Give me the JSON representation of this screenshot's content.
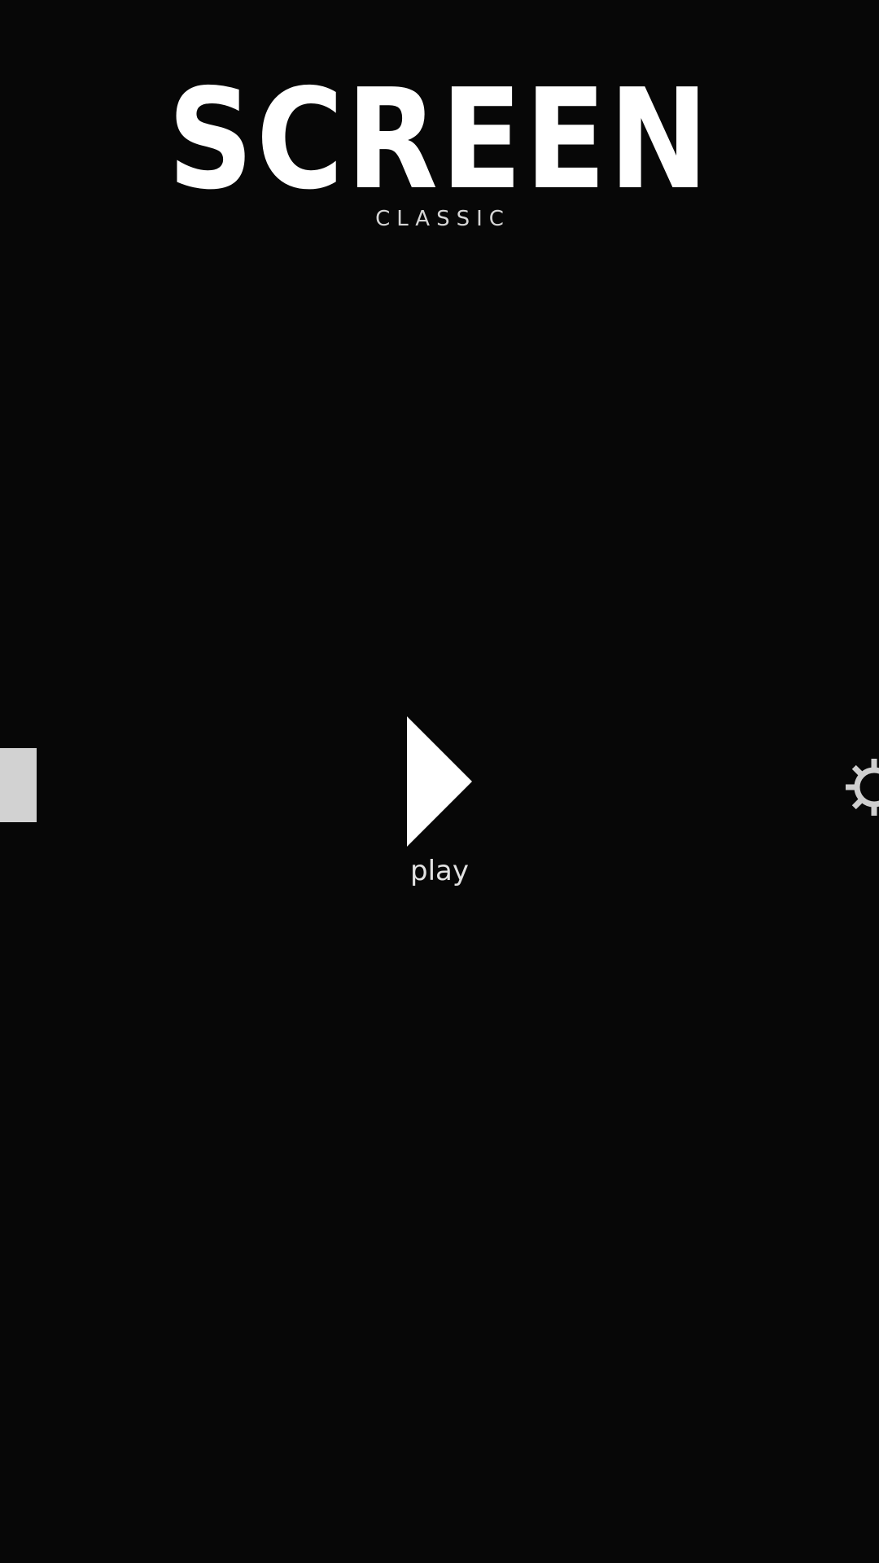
{
  "header": {
    "title": "SCREEN",
    "subtitle": "CLASSIC"
  },
  "play": {
    "label": "play",
    "icon": "play-triangle-icon"
  },
  "side_controls": {
    "left_tab_icon": "panel-tab-icon",
    "right_icon": "gear-icon"
  },
  "colors": {
    "background": "#070707",
    "title": "#ffffff",
    "subtitle": "#d6d6d6",
    "left_tab": "#d2d2d2",
    "gear": "#cfcfcf"
  }
}
